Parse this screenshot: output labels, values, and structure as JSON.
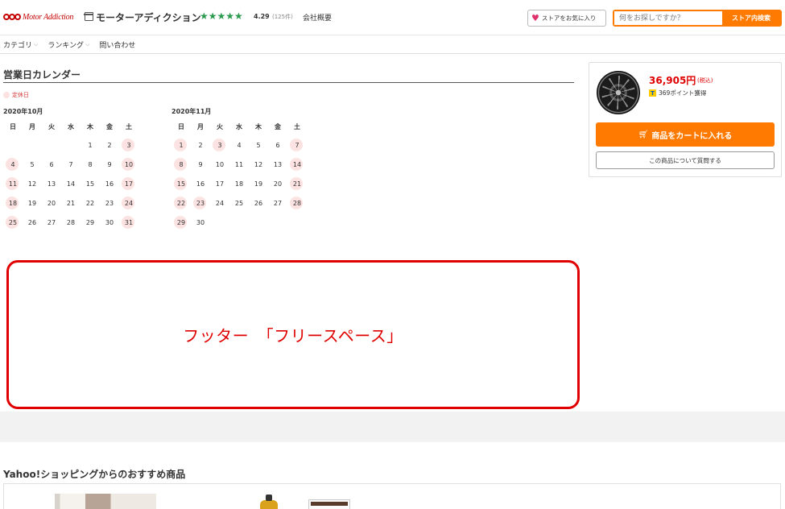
{
  "header": {
    "logo_text": "Motor Addiction",
    "store_name": "モーターアディクション",
    "stars": "★★★★★",
    "rating": "4.29",
    "rating_count": "(125件)",
    "about_link": "会社概要",
    "favorite_button": "ストアをお気に入り",
    "search_placeholder": "何をお探しですか？",
    "search_button": "ストア内検索"
  },
  "nav": {
    "items": [
      {
        "label": "カテゴリ",
        "has_dropdown": true
      },
      {
        "label": "ランキング",
        "has_dropdown": true
      },
      {
        "label": "問い合わせ",
        "has_dropdown": false
      }
    ]
  },
  "calendar": {
    "title": "営業日カレンダー",
    "legend_label": "定休日",
    "weekdays": [
      "日",
      "月",
      "火",
      "水",
      "木",
      "金",
      "土"
    ],
    "months": [
      {
        "title": "2020年10月",
        "days": [
          "",
          "",
          "",
          "",
          "1",
          "2",
          "3",
          "4",
          "5",
          "6",
          "7",
          "8",
          "9",
          "10",
          "11",
          "12",
          "13",
          "14",
          "15",
          "16",
          "17",
          "18",
          "19",
          "20",
          "21",
          "22",
          "23",
          "24",
          "25",
          "26",
          "27",
          "28",
          "29",
          "30",
          "31"
        ],
        "holidays": [
          "3",
          "4",
          "10",
          "11",
          "17",
          "18",
          "24",
          "25",
          "31"
        ]
      },
      {
        "title": "2020年11月",
        "days": [
          "1",
          "2",
          "3",
          "4",
          "5",
          "6",
          "7",
          "8",
          "9",
          "10",
          "11",
          "12",
          "13",
          "14",
          "15",
          "16",
          "17",
          "18",
          "19",
          "20",
          "21",
          "22",
          "23",
          "24",
          "25",
          "26",
          "27",
          "28",
          "29",
          "30"
        ],
        "holidays": [
          "1",
          "3",
          "7",
          "8",
          "14",
          "15",
          "21",
          "22",
          "23",
          "28",
          "29"
        ]
      }
    ]
  },
  "footer": {
    "free_space_text": "フッター　「フリースペース」",
    "recommend_title": "Yahoo!ショッピングからのおすすめ商品"
  },
  "product": {
    "price": "36,905円",
    "tax_label": "(税込)",
    "points_label": "369ポイント獲得",
    "cart_button": "商品をカートに入れる",
    "ask_button": "この商品について質問する"
  },
  "colors": {
    "accent": "#ff7a00",
    "price": "#e00000",
    "holiday_bg": "#fde2e2",
    "stars": "#2c9a4f"
  }
}
